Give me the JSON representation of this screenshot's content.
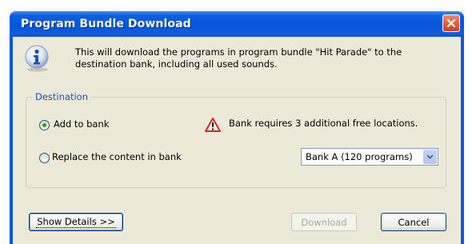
{
  "window": {
    "title": "Program Bundle Download"
  },
  "message": "This will download the programs in program bundle \"Hit Parade\" to the destination bank, including all used sounds.",
  "destination": {
    "legend": "Destination",
    "add_label": "Add to bank",
    "replace_label": "Replace the content in bank",
    "selected": "add",
    "warning": "Bank requires 3 additional free locations.",
    "bank_select": "Bank A (120 programs)"
  },
  "buttons": {
    "details": "Show Details >>",
    "download": "Download",
    "cancel": "Cancel"
  },
  "colors": {
    "title_bar": "#0a59d8",
    "dialog_bg": "#ece9d8",
    "legend": "#1c4cc8",
    "warning": "#d6261e"
  }
}
